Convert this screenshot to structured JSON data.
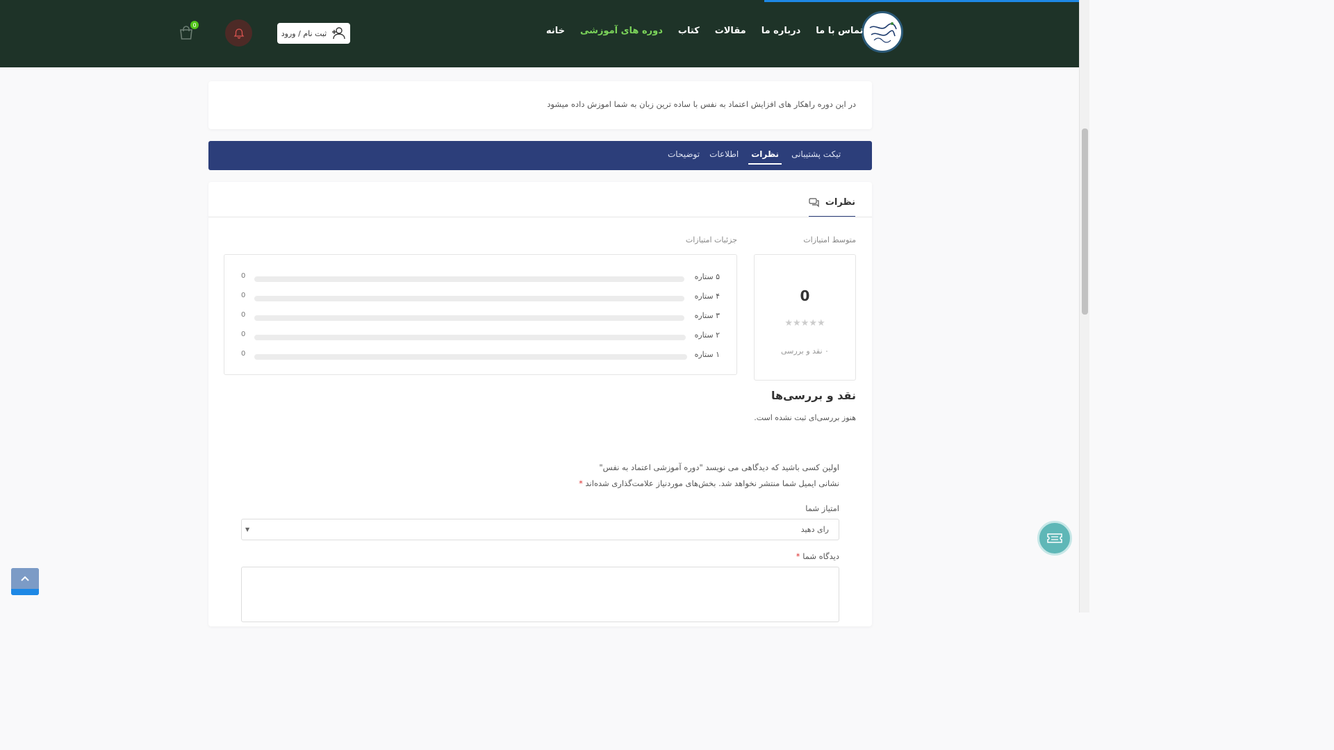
{
  "header": {
    "nav": [
      {
        "label": "خانه",
        "active": false
      },
      {
        "label": "دوره های آموزشی",
        "active": true
      },
      {
        "label": "کتاب",
        "active": false
      },
      {
        "label": "مقالات",
        "active": false
      },
      {
        "label": "درباره ما",
        "active": false
      },
      {
        "label": "تماس با ما",
        "active": false
      }
    ],
    "login_label": "ثبت نام / ورود",
    "cart_count": "0",
    "logo_icon": "logo-icon",
    "accent_color": "#7bd35a",
    "bg_color": "#1e3328"
  },
  "description": {
    "text": "در این دوره راهکار های افزایش اعتماد به نفس با ساده ترین زبان به شما اموزش داده میشود"
  },
  "tabs": [
    {
      "label": "توضیحات",
      "active": false
    },
    {
      "label": "اطلاعات",
      "active": false
    },
    {
      "label": "نظرات",
      "active": true
    },
    {
      "label": "تیکت پشتیبانی",
      "active": false
    }
  ],
  "reviews": {
    "heading": "نظرات",
    "avg_label": "متوسط امتیازات",
    "detail_label": "جزئیات امتیازات",
    "avg_value": "0",
    "avg_stars": "★★★★★",
    "avg_count": "۰ نقد و بررسی",
    "bars": [
      {
        "label": "۵ ستاره",
        "count": "0",
        "fraction": 0
      },
      {
        "label": "۴ ستاره",
        "count": "0",
        "fraction": 0
      },
      {
        "label": "۳ ستاره",
        "count": "0",
        "fraction": 0
      },
      {
        "label": "۲ ستاره",
        "count": "0",
        "fraction": 0
      },
      {
        "label": "۱ ستاره",
        "count": "0",
        "fraction": 0
      }
    ],
    "title": "نقد و بررسی‌ها",
    "no_reviews": "هنوز بررسی‌ای ثبت نشده است."
  },
  "form": {
    "be_first": "اولین کسی باشید که دیدگاهی می نویسد \"دوره آموزشی اعتماد به نفس\"",
    "email_note": "نشانی ایمیل شما منتشر نخواهد شد. بخش‌های موردنیاز علامت‌گذاری شده‌اند",
    "required_mark": "*",
    "rating_label": "امتیاز شما",
    "rating_value": "رای دهید",
    "comment_label": "دیدگاه شما",
    "comment_value": ""
  }
}
